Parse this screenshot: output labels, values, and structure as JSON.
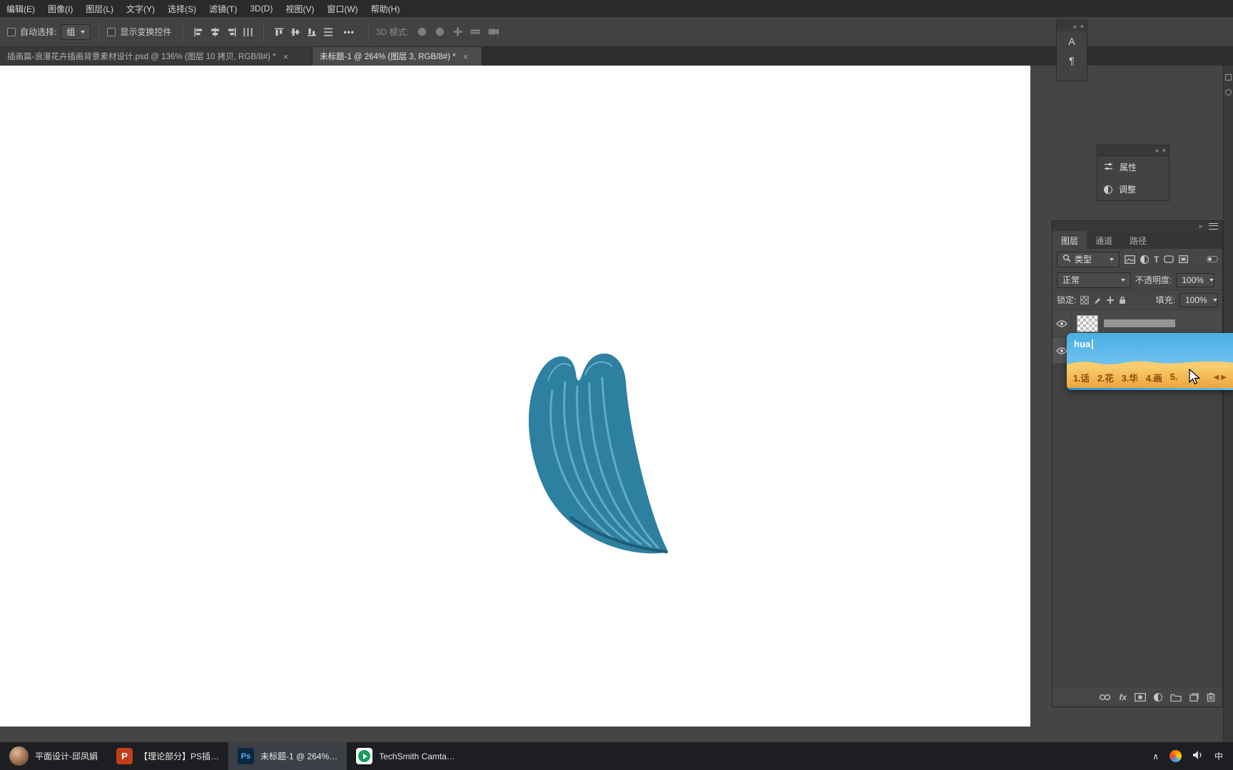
{
  "menubar": {
    "items": [
      "编辑(E)",
      "图像(I)",
      "图层(L)",
      "文字(Y)",
      "选择(S)",
      "滤镜(T)",
      "3D(D)",
      "视图(V)",
      "窗口(W)",
      "帮助(H)"
    ]
  },
  "optionsbar": {
    "auto_select_label": "自动选择:",
    "auto_select_value": "组",
    "show_transform_label": "显示变换控件",
    "more_glyph": "•••",
    "mode3d_label": "3D 模式:"
  },
  "dock": {
    "collapse_glyph": "»",
    "close_glyph": "×",
    "character_glyph": "A",
    "paragraph_glyph": "¶"
  },
  "tabs": {
    "tab1": "插画篇-浪漫花卉插画背景素材设计.psd @ 136% (图层 10 拷贝, RGB/8#) *",
    "tab2": "未标题-1 @ 264% (图层 3, RGB/8#) *",
    "close_glyph": "×"
  },
  "floatpanel": {
    "collapse_glyph": "»",
    "close_glyph": "×",
    "properties_label": "属性",
    "adjustments_label": "调整"
  },
  "layers": {
    "collapse_glyph": "»",
    "tab_layers": "图层",
    "tab_channels": "通道",
    "tab_paths": "路径",
    "filter_label": "类型",
    "type_icon_glyph": "T",
    "blend_mode": "正常",
    "opacity_label": "不透明度:",
    "opacity_value": "100%",
    "lock_label": "锁定:",
    "fill_label": "填充:",
    "fill_value": "100%",
    "fx_label": "fx"
  },
  "ime": {
    "composition": "hua",
    "candidates": [
      "1.话",
      "2.花",
      "3.华",
      "4.画",
      "5."
    ],
    "pager_prev": "◀",
    "pager_next": "▶"
  },
  "taskbar": {
    "people_label": "平面设计-邱凤娟",
    "ppt_label": "【理论部分】PS插…",
    "ppt_glyph": "P",
    "ps_label": "未标题-1 @ 264%…",
    "ps_glyph": "Ps",
    "cam_label": "TechSmith Camta…",
    "tray_expand_glyph": "∧",
    "ime_indicator": "中"
  },
  "colors": {
    "leaf_main": "#2e80a1",
    "leaf_vein": "#68b0c6",
    "ime_sky": "#49aee6",
    "ime_sand": "#efa53d"
  }
}
